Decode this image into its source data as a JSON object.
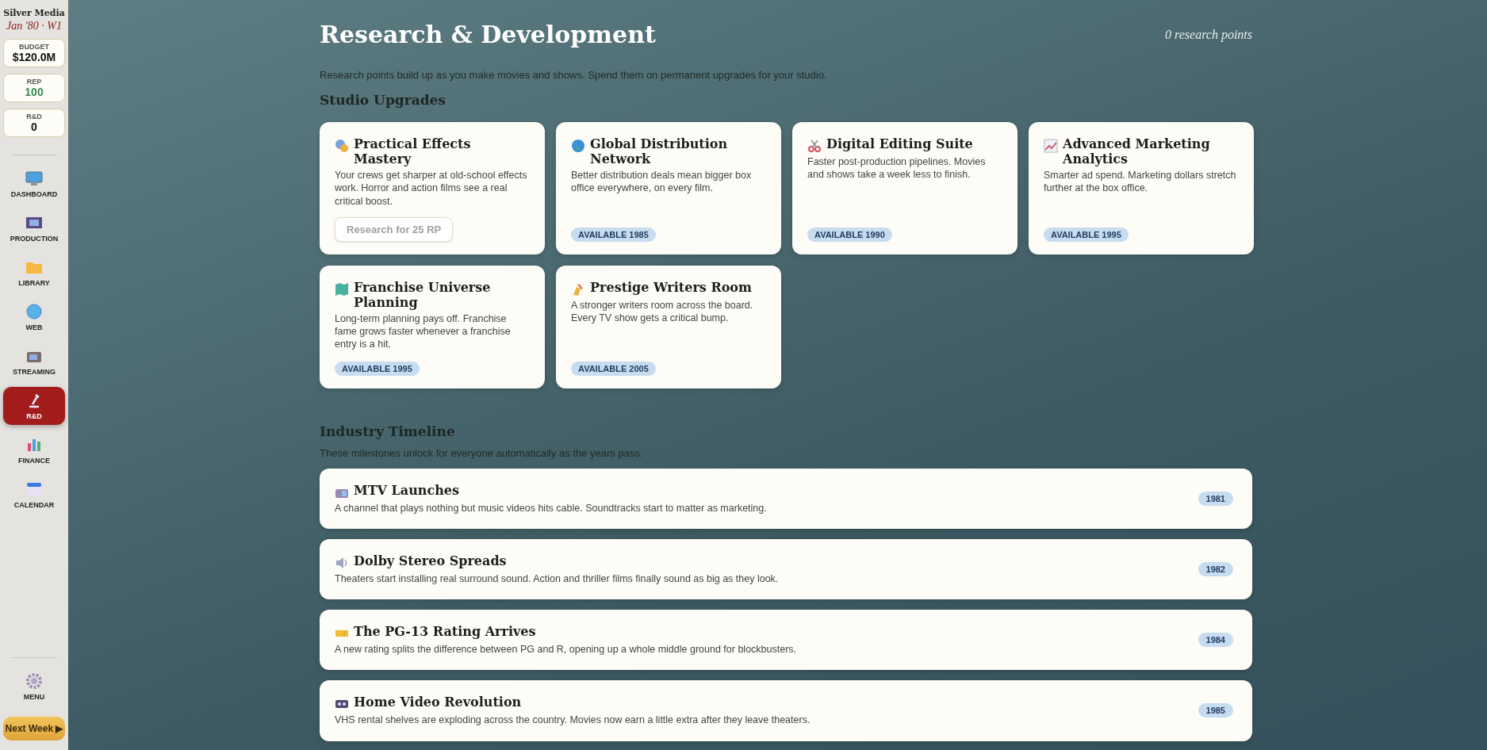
{
  "sidebar": {
    "studio": "Silver Media",
    "date": "Jan '80 · W1",
    "stats": [
      {
        "label": "BUDGET",
        "value": "$120.0M",
        "kind": "money"
      },
      {
        "label": "REP",
        "value": "100",
        "kind": "rep"
      },
      {
        "label": "R&D",
        "value": "0",
        "kind": "plain"
      }
    ],
    "nav": [
      {
        "label": "DASHBOARD",
        "selected": false
      },
      {
        "label": "PRODUCTION",
        "selected": false
      },
      {
        "label": "LIBRARY",
        "selected": false
      },
      {
        "label": "WEB",
        "selected": false
      },
      {
        "label": "STREAMING",
        "selected": false
      },
      {
        "label": "R&D",
        "selected": true
      },
      {
        "label": "FINANCE",
        "selected": false
      },
      {
        "label": "CALENDAR",
        "selected": false
      }
    ],
    "menu": "MENU",
    "next_week": "Next Week ▶"
  },
  "header": {
    "title": "Research & Development",
    "points": "0 research points",
    "intro": "Research points build up as you make movies and shows. Spend them on permanent upgrades for your studio."
  },
  "upgrades": {
    "heading": "Studio Upgrades",
    "cards": [
      {
        "title": "Practical Effects Mastery",
        "text": "Your crews get sharper at old-school effects work. Horror and action films see a real critical boost.",
        "kind": "researchable",
        "button": "Research for 25 RP",
        "disabled": true
      },
      {
        "title": "Global Distribution Network",
        "text": "Better distribution deals mean bigger box office everywhere, on every film.",
        "kind": "locked",
        "badge": "AVAILABLE 1985"
      },
      {
        "title": "Digital Editing Suite",
        "text": "Faster post-production pipelines. Movies and shows take a week less to finish.",
        "kind": "locked",
        "badge": "AVAILABLE 1990"
      },
      {
        "title": "Advanced Marketing Analytics",
        "text": "Smarter ad spend. Marketing dollars stretch further at the box office.",
        "kind": "locked",
        "badge": "AVAILABLE 1995"
      },
      {
        "title": "Franchise Universe Planning",
        "text": "Long-term planning pays off. Franchise fame grows faster whenever a franchise entry is a hit.",
        "kind": "locked",
        "badge": "AVAILABLE 1995"
      },
      {
        "title": "Prestige Writers Room",
        "text": "A stronger writers room across the board. Every TV show gets a critical bump.",
        "kind": "locked",
        "badge": "AVAILABLE 2005"
      }
    ]
  },
  "timeline": {
    "heading": "Industry Timeline",
    "intro": "These milestones unlock for everyone automatically as the years pass.",
    "events": [
      {
        "title": "MTV Launches",
        "text": "A channel that plays nothing but music videos hits cable. Soundtracks start to matter as marketing.",
        "year": "1981"
      },
      {
        "title": "Dolby Stereo Spreads",
        "text": "Theaters start installing real surround sound. Action and thriller films finally sound as big as they look.",
        "year": "1982"
      },
      {
        "title": "The PG-13 Rating Arrives",
        "text": "A new rating splits the difference between PG and R, opening up a whole middle ground for blockbusters.",
        "year": "1984"
      },
      {
        "title": "Home Video Revolution",
        "text": "VHS rental shelves are exploding across the country. Movies now earn a little extra after they leave theaters.",
        "year": "1985"
      }
    ]
  }
}
